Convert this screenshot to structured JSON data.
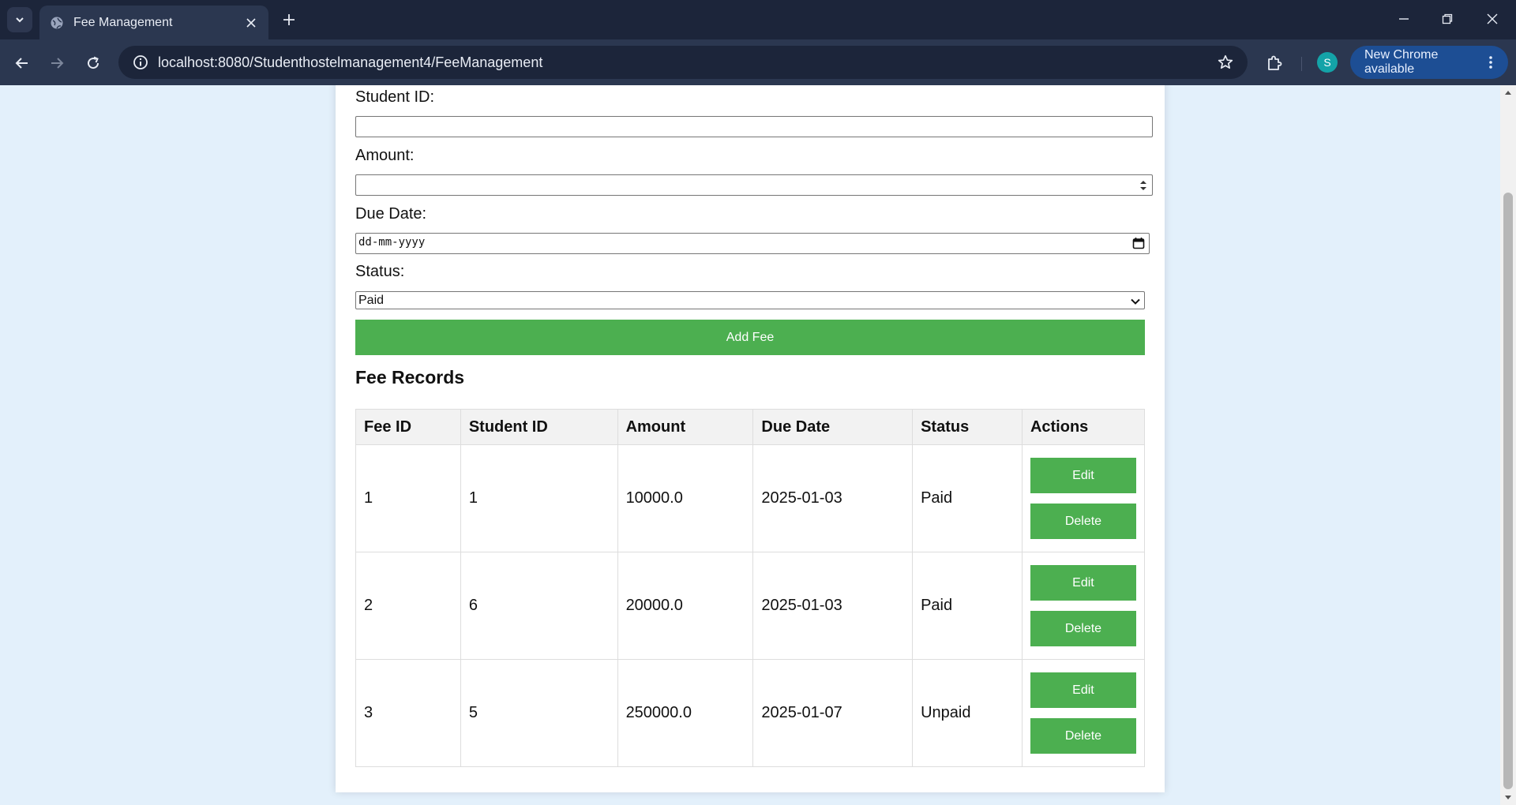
{
  "browser": {
    "tab_title": "Fee Management",
    "url": "localhost:8080/Studenthostelmanagement4/FeeManagement",
    "avatar_letter": "S",
    "update_label": "New Chrome available"
  },
  "form": {
    "student_id_label": "Student ID:",
    "student_id_value": "",
    "amount_label": "Amount:",
    "amount_value": "",
    "due_date_label": "Due Date:",
    "due_date_placeholder": "dd-mm-yyyy",
    "status_label": "Status:",
    "status_selected": "Paid",
    "submit_label": "Add Fee"
  },
  "records": {
    "title": "Fee Records",
    "headers": [
      "Fee ID",
      "Student ID",
      "Amount",
      "Due Date",
      "Status",
      "Actions"
    ],
    "rows": [
      {
        "fee_id": "1",
        "student_id": "1",
        "amount": "10000.0",
        "due_date": "2025-01-03",
        "status": "Paid"
      },
      {
        "fee_id": "2",
        "student_id": "6",
        "amount": "20000.0",
        "due_date": "2025-01-03",
        "status": "Paid"
      },
      {
        "fee_id": "3",
        "student_id": "5",
        "amount": "250000.0",
        "due_date": "2025-01-07",
        "status": "Unpaid"
      }
    ],
    "edit_label": "Edit",
    "delete_label": "Delete"
  },
  "colors": {
    "accent_green": "#4caf50",
    "page_background": "#e3f0fb",
    "chrome_frame": "#1c253a"
  }
}
